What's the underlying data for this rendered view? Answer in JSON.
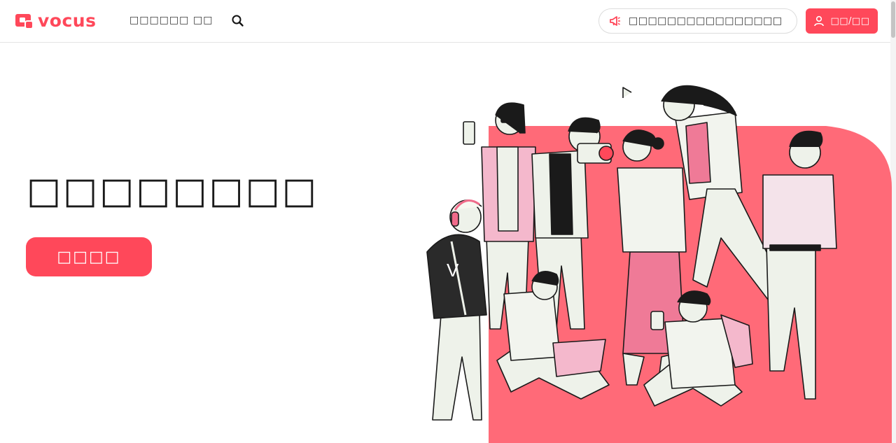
{
  "header": {
    "logo_text": "vocus",
    "nav": [
      {
        "label": "□□□□□□",
        "icon": ""
      },
      {
        "label": "□□",
        "icon": ""
      }
    ],
    "search_icon": "search-icon",
    "announcement": {
      "icon": "megaphone-icon",
      "text": "□□□□□□□□□□□□□□□□"
    },
    "login": {
      "icon": "user-icon",
      "label": "□□/□□"
    }
  },
  "hero": {
    "title": "□□□□□□□□",
    "cta_label": "□□□□",
    "illustration": "group-of-people-illustration"
  },
  "colors": {
    "brand": "#ff485a",
    "illustration_bg": "#ff6a78",
    "pink_light": "#f4b8cc",
    "text_dark": "#1a1a1a"
  }
}
